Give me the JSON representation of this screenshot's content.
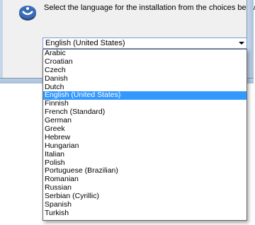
{
  "window": {
    "prompt": "Select the language for the installation from the choices below."
  },
  "combo": {
    "selected_value": "English (United States)"
  },
  "dropdown": {
    "options": [
      {
        "label": "Arabic",
        "selected": false
      },
      {
        "label": "Croatian",
        "selected": false
      },
      {
        "label": "Czech",
        "selected": false
      },
      {
        "label": "Danish",
        "selected": false
      },
      {
        "label": "Dutch",
        "selected": false
      },
      {
        "label": "English (United States)",
        "selected": true
      },
      {
        "label": "Finnish",
        "selected": false
      },
      {
        "label": "French (Standard)",
        "selected": false
      },
      {
        "label": "German",
        "selected": false
      },
      {
        "label": "Greek",
        "selected": false
      },
      {
        "label": "Hebrew",
        "selected": false
      },
      {
        "label": "Hungarian",
        "selected": false
      },
      {
        "label": "Italian",
        "selected": false
      },
      {
        "label": "Polish",
        "selected": false
      },
      {
        "label": "Portuguese (Brazilian)",
        "selected": false
      },
      {
        "label": "Romanian",
        "selected": false
      },
      {
        "label": "Russian",
        "selected": false
      },
      {
        "label": "Serbian (Cyrillic)",
        "selected": false
      },
      {
        "label": "Spanish",
        "selected": false
      },
      {
        "label": "Turkish",
        "selected": false
      }
    ]
  },
  "colors": {
    "highlight": "#3399ff",
    "highlight_text": "#ffffff",
    "dialog_bg": "#f0f0f0"
  },
  "icons": {
    "app_icon": "globe-language-icon",
    "dropdown_arrow": "chevron-down-icon"
  }
}
